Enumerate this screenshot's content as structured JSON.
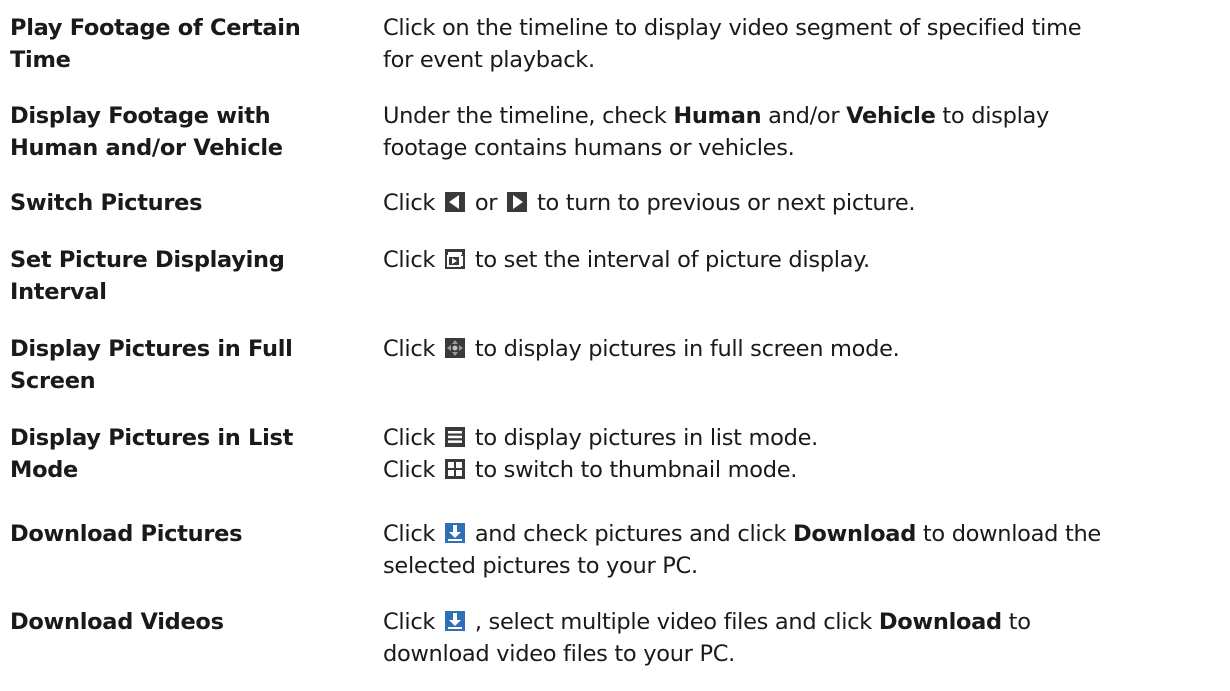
{
  "rows": [
    {
      "term": [
        "Play Footage of Certain",
        "Time"
      ],
      "desc": {
        "l1": "Click on the timeline to display video segment of specified time",
        "l2": "for event playback."
      }
    },
    {
      "term": [
        "Display Footage with",
        "Human and/or Vehicle"
      ],
      "desc": {
        "l1a": "Under the timeline, check ",
        "l1b": "Human",
        "l1c": " and/or ",
        "l1d": "Vehicle",
        "l1e": " to display",
        "l2": "footage contains humans or vehicles."
      }
    },
    {
      "term": [
        "Switch Pictures"
      ],
      "desc": {
        "a": "Click ",
        "b": " or ",
        "c": " to turn to previous or next picture."
      },
      "icons": [
        "previous-picture-icon",
        "next-picture-icon"
      ]
    },
    {
      "term": [
        "Set Picture Displaying",
        "Interval"
      ],
      "desc": {
        "a": "Click ",
        "b": " to set the interval of picture display."
      },
      "icons": [
        "picture-interval-icon"
      ]
    },
    {
      "term": [
        "Display Pictures in Full",
        "Screen"
      ],
      "desc": {
        "a": "Click ",
        "b": " to display pictures in full screen mode."
      },
      "icons": [
        "full-screen-icon"
      ]
    },
    {
      "term": [
        "Display Pictures in List",
        "Mode"
      ],
      "desc": {
        "a1": "Click ",
        "b1": " to display pictures in list mode.",
        "a2": "Click ",
        "b2": " to switch to thumbnail mode."
      },
      "icons": [
        "list-mode-icon",
        "thumbnail-mode-icon"
      ]
    },
    {
      "term": [
        "Download Pictures"
      ],
      "desc": {
        "a": "Click ",
        "b": " and check pictures and click ",
        "c": "Download",
        "d": " to download the",
        "l2": "selected pictures to your PC."
      },
      "icons": [
        "download-icon"
      ]
    },
    {
      "term": [
        "Download Videos"
      ],
      "desc": {
        "a": "Click ",
        "b": " , select multiple video files and click ",
        "c": "Download",
        "d": " to",
        "l2": "download video files to your PC."
      },
      "icons": [
        "download-icon"
      ]
    }
  ],
  "colors": {
    "text": "#1a1a1a",
    "icon_dark": "#3a3a3a",
    "icon_blue": "#2f6fb5",
    "icon_gray": "#9a9a9a"
  }
}
